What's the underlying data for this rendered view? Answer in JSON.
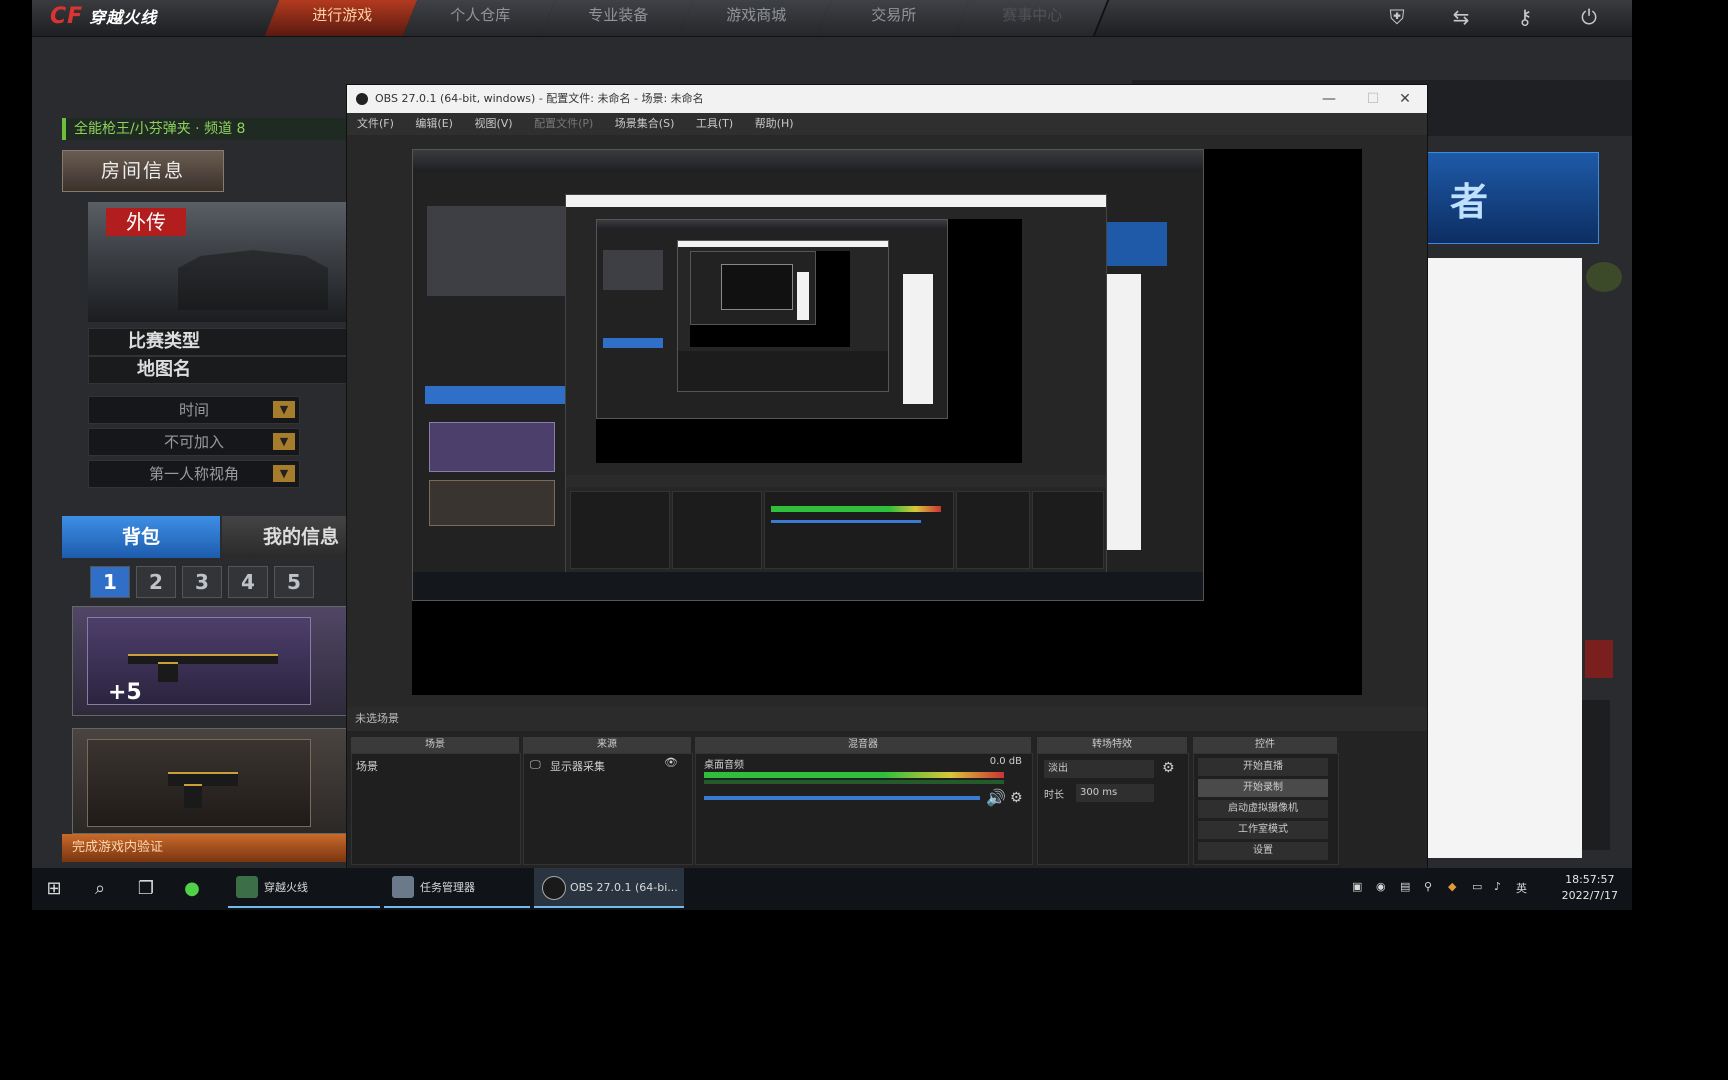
{
  "game": {
    "logo_main": "CF",
    "logo_sub": "穿越火线",
    "nav": [
      "进行游戏",
      "个人仓库",
      "专业装备",
      "游戏商城",
      "交易所",
      "赛事中心"
    ],
    "room_title": "全能枪王/小芬弹夹 · 频道 8",
    "room_info_button": "房间信息",
    "map_tag": "外传",
    "info_rows": [
      {
        "key": "比赛类型"
      },
      {
        "key": "地图名"
      }
    ],
    "selects": [
      "时间",
      "不可加入",
      "第一人称视角"
    ],
    "tabs": {
      "bag": "背包",
      "myinfo": "我的信息"
    },
    "pages": [
      "1",
      "2",
      "3",
      "4",
      "5"
    ],
    "item_level": "+5",
    "tip": "完成游戏内验证",
    "right_big": "者"
  },
  "obs": {
    "title": "OBS 27.0.1 (64-bit, windows) - 配置文件: 未命名 - 场景: 未命名",
    "menu": [
      "文件(F)",
      "编辑(E)",
      "视图(V)",
      "配置文件(P)",
      "场景集合(S)",
      "工具(T)",
      "帮助(H)"
    ],
    "scenebar_label": "未选场景",
    "dock_headers": [
      "场景",
      "来源",
      "混音器",
      "转场特效",
      "控件"
    ],
    "scene_item": "场景",
    "source_item": "显示器采集",
    "mixer_label": "桌面音频",
    "mixer_db": "0.0 dB",
    "transition_select": "淡出",
    "duration_label": "时长",
    "duration_value": "300 ms",
    "controls": [
      "开始直播",
      "开始录制",
      "启动虚拟摄像机",
      "工作室模式",
      "设置"
    ]
  },
  "taskbar": {
    "apps": [
      "穿越火线",
      "任务管理器",
      "OBS 27.0.1 (64-bi..."
    ],
    "ime": "英",
    "time": "18:57:57",
    "date": "2022/7/17"
  }
}
